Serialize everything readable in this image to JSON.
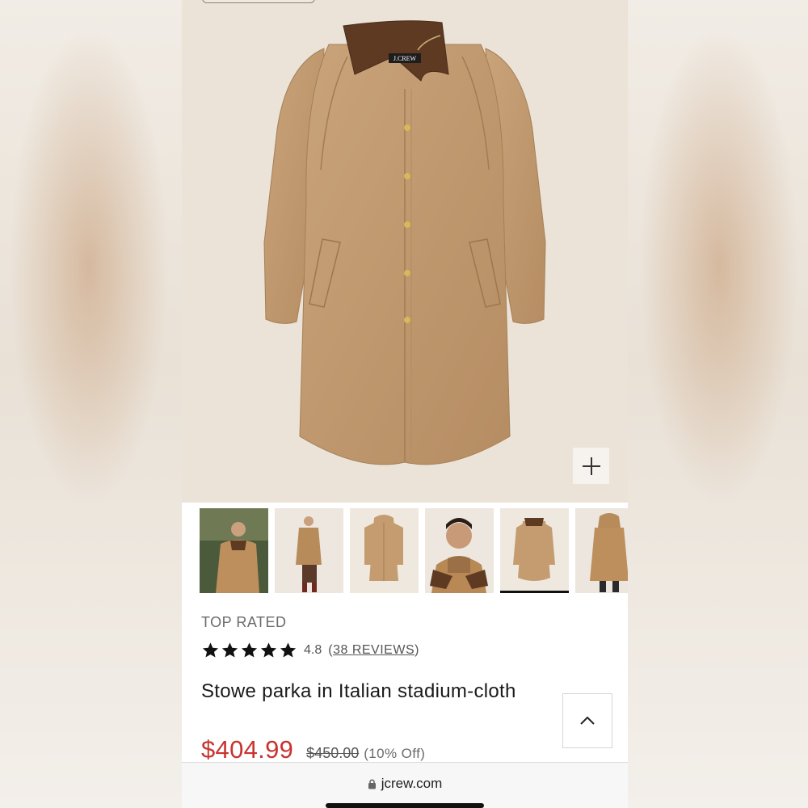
{
  "product": {
    "badge": "TOP RATED",
    "rating_value": "4.8",
    "reviews_open": "(",
    "reviews_text": "38 REVIEWS",
    "reviews_close": ")",
    "stars": 5,
    "name": "Stowe parka in Italian stadium-cloth",
    "sale_price": "$404.99",
    "original_price": "$450.00",
    "discount": "(10% Off)"
  },
  "hero": {
    "collar_label": "J.CREW",
    "zoom_icon": "plus-icon"
  },
  "thumbnails": [
    {
      "name": "thumbnail-model-forest",
      "active": false
    },
    {
      "name": "thumbnail-model-full-length",
      "active": false
    },
    {
      "name": "thumbnail-coat-hood",
      "active": false
    },
    {
      "name": "thumbnail-model-smiling",
      "active": false
    },
    {
      "name": "thumbnail-coat-flat",
      "active": true
    },
    {
      "name": "thumbnail-model-back",
      "active": false
    }
  ],
  "browser": {
    "url": "jcrew.com",
    "lock_icon": "lock-icon"
  },
  "colors": {
    "sale_red": "#c8342f",
    "coat_camel": "#c19a71",
    "collar_brown": "#5e3a22"
  }
}
